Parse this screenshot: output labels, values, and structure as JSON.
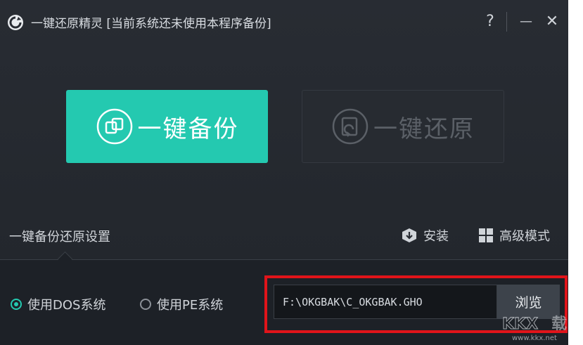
{
  "window": {
    "title": "一键还原精灵 [当前系统还未使用本程序备份]",
    "help_label": "?",
    "minimize_label": "—",
    "close_label": "✕"
  },
  "main": {
    "backup_label": "一键备份",
    "restore_label": "一键还原"
  },
  "settings": {
    "title": "一键备份还原设置",
    "install_label": "安装",
    "advanced_label": "高级模式",
    "options": [
      {
        "label": "使用DOS系统",
        "checked": true
      },
      {
        "label": "使用PE系统",
        "checked": false
      }
    ],
    "path_value": "F:\\OKGBAK\\C_OKGBAK.GHO",
    "browse_label": "浏览"
  },
  "colors": {
    "accent": "#24c9b0",
    "highlight": "#e0141a"
  },
  "watermark": {
    "url": "www.kkx.net"
  }
}
